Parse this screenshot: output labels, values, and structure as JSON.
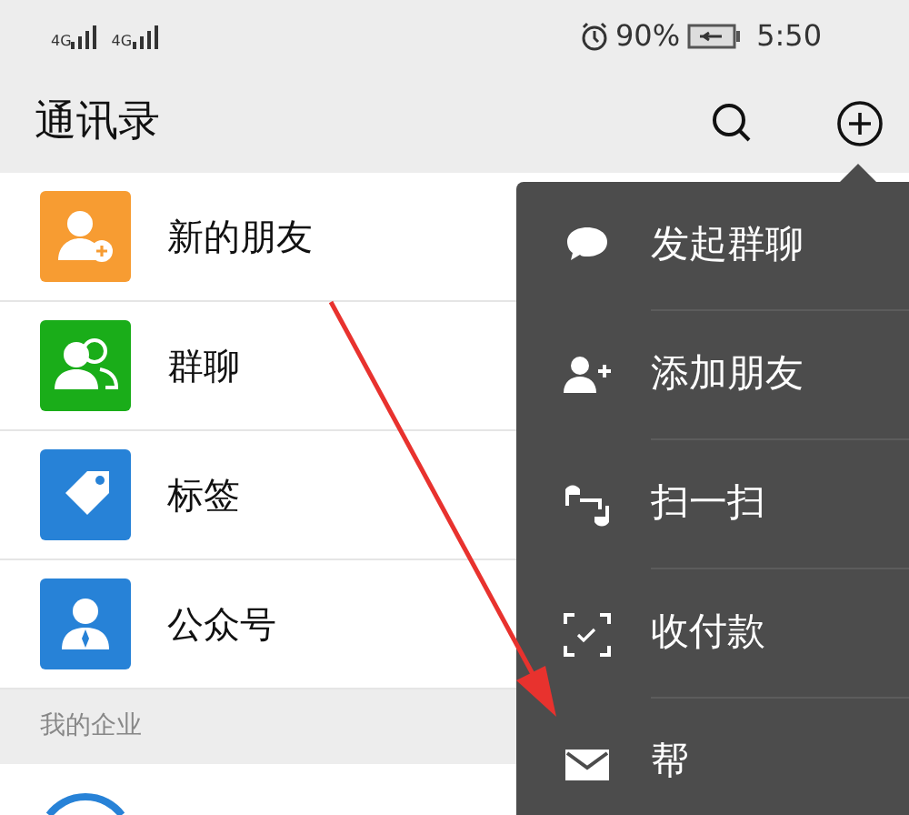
{
  "status_bar": {
    "networks": [
      "4G",
      "4G"
    ],
    "battery": "90%",
    "time": "5:50"
  },
  "header": {
    "title": "通讯录"
  },
  "contacts": [
    {
      "kind": "new-friend",
      "label": "新的朋友",
      "color": "#f79c32"
    },
    {
      "kind": "group",
      "label": "群聊",
      "color": "#1aad19"
    },
    {
      "kind": "tag",
      "label": "标签",
      "color": "#2782d7"
    },
    {
      "kind": "official",
      "label": "公众号",
      "color": "#2782d7"
    }
  ],
  "section": {
    "title": "我的企业"
  },
  "menu": [
    {
      "kind": "group-chat",
      "label": "发起群聊"
    },
    {
      "kind": "add-friend",
      "label": "添加朋友"
    },
    {
      "kind": "scan",
      "label": "扫一扫"
    },
    {
      "kind": "money",
      "label": "收付款"
    },
    {
      "kind": "mail",
      "label": "帮"
    }
  ]
}
